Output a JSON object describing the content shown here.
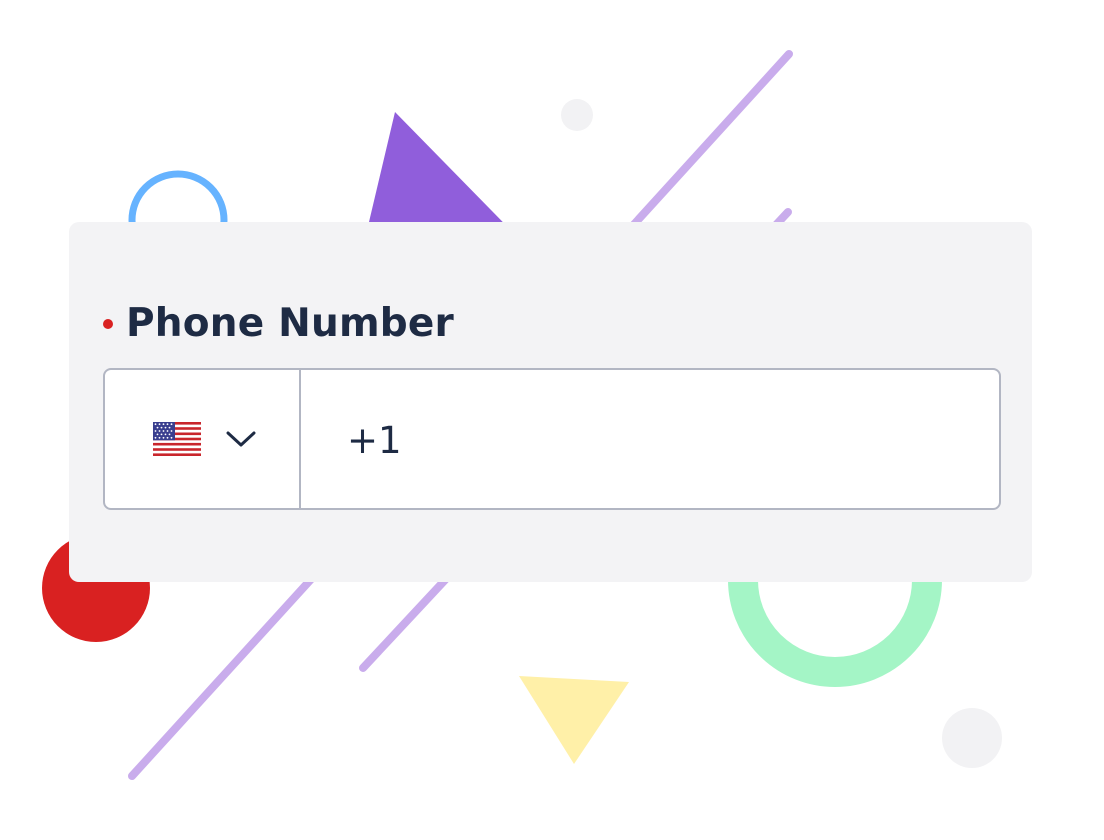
{
  "field": {
    "label": "Phone Number",
    "required": true,
    "country": {
      "flag_icon": "us-flag-icon",
      "chevron_icon": "chevron-down-icon"
    },
    "input_value": "+1"
  },
  "colors": {
    "card_background": "#f3f3f5",
    "label_text": "#1e2b44",
    "required_dot": "#d92121",
    "field_border": "#b2b6c3",
    "decor_purple": "#905edb",
    "decor_lavender": "#c9acec",
    "decor_blue": "#66b3ff",
    "decor_red": "#d92121",
    "decor_green": "#a4f5c6",
    "decor_yellow": "#fff0a8",
    "decor_grey": "#f2f2f4"
  }
}
